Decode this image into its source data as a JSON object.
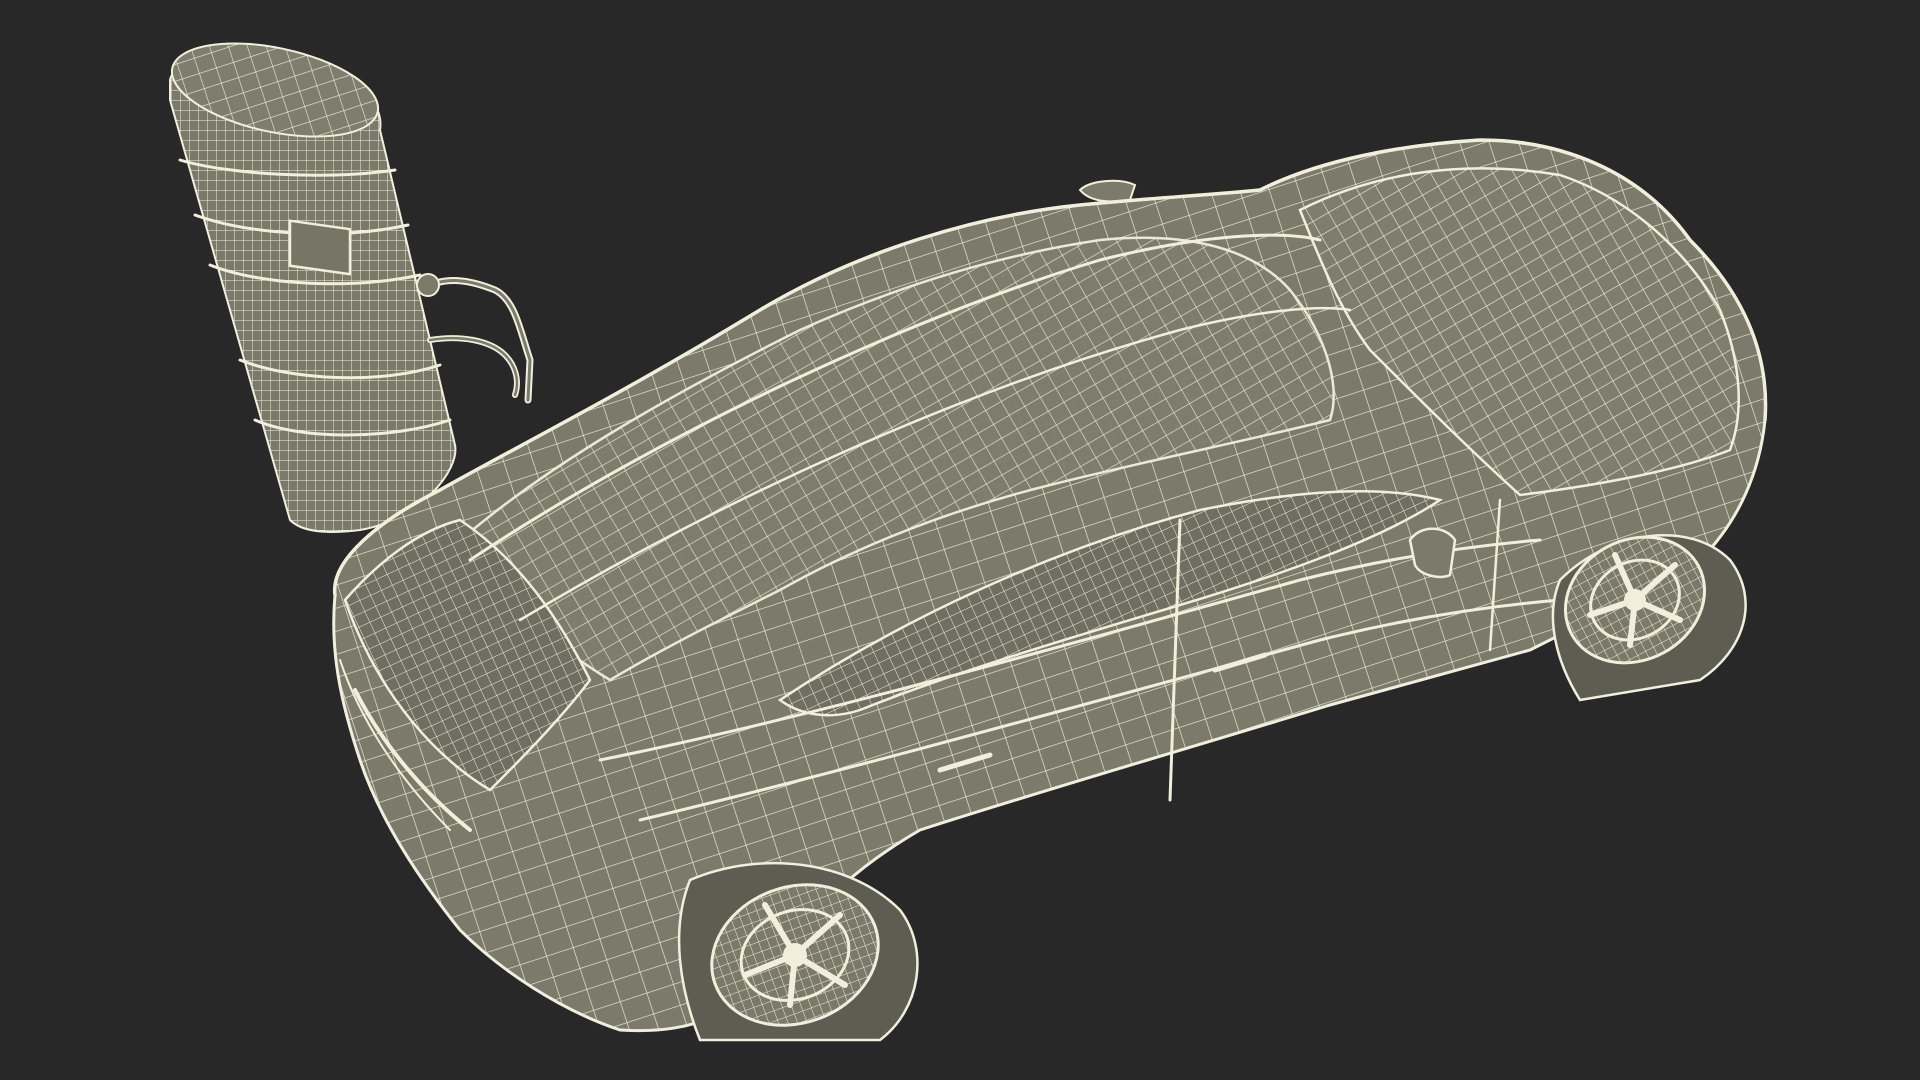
{
  "scene": {
    "background_color": "#282828",
    "mesh_fill_color": "#7d7c6d",
    "mesh_fill_dark_color": "#6f6e61",
    "wire_color": "#f1efdc",
    "objects": [
      {
        "name": "ev-charging-station",
        "icon": "charging-station-icon"
      },
      {
        "name": "electric-car",
        "icon": "car-icon"
      }
    ]
  }
}
